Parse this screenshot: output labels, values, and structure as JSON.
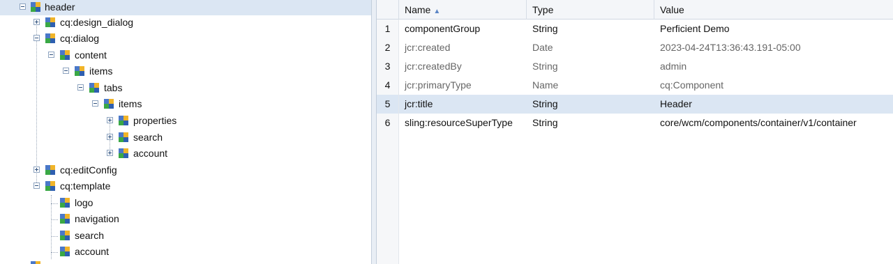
{
  "tree": {
    "nodes": [
      {
        "label": "header",
        "toggle": "minus"
      },
      {
        "label": "cq:design_dialog",
        "toggle": "plus"
      },
      {
        "label": "cq:dialog",
        "toggle": "minus"
      },
      {
        "label": "content",
        "toggle": "minus"
      },
      {
        "label": "items",
        "toggle": "minus"
      },
      {
        "label": "tabs",
        "toggle": "minus"
      },
      {
        "label": "items",
        "toggle": "minus"
      },
      {
        "label": "properties",
        "toggle": "plus"
      },
      {
        "label": "search",
        "toggle": "plus"
      },
      {
        "label": "account",
        "toggle": "plus"
      },
      {
        "label": "cq:editConfig",
        "toggle": "plus"
      },
      {
        "label": "cq:template",
        "toggle": "minus"
      },
      {
        "label": "logo",
        "toggle": "none"
      },
      {
        "label": "navigation",
        "toggle": "none"
      },
      {
        "label": "search",
        "toggle": "none"
      },
      {
        "label": "account",
        "toggle": "none"
      }
    ]
  },
  "grid": {
    "columns": {
      "name": "Name",
      "type": "Type",
      "value": "Value"
    },
    "sort_column": "Name",
    "rows": [
      {
        "num": "1",
        "name": "componentGroup",
        "type": "String",
        "value": "Perficient Demo",
        "protected": false
      },
      {
        "num": "2",
        "name": "jcr:created",
        "type": "Date",
        "value": "2023-04-24T13:36:43.191-05:00",
        "protected": true
      },
      {
        "num": "3",
        "name": "jcr:createdBy",
        "type": "String",
        "value": "admin",
        "protected": true
      },
      {
        "num": "4",
        "name": "jcr:primaryType",
        "type": "Name",
        "value": "cq:Component",
        "protected": true
      },
      {
        "num": "5",
        "name": "jcr:title",
        "type": "String",
        "value": "Header",
        "protected": false
      },
      {
        "num": "6",
        "name": "sling:resourceSuperType",
        "type": "String",
        "value": "core/wcm/components/container/v1/container",
        "protected": false
      }
    ],
    "selected_row": "5"
  },
  "icons": {
    "node": "jcr-node-icon",
    "toggle_plus": "expand-icon",
    "toggle_minus": "collapse-icon"
  },
  "colors": {
    "selection": "#dbe6f3",
    "header_bg": "#f4f6f9",
    "protected_text": "#666666"
  }
}
